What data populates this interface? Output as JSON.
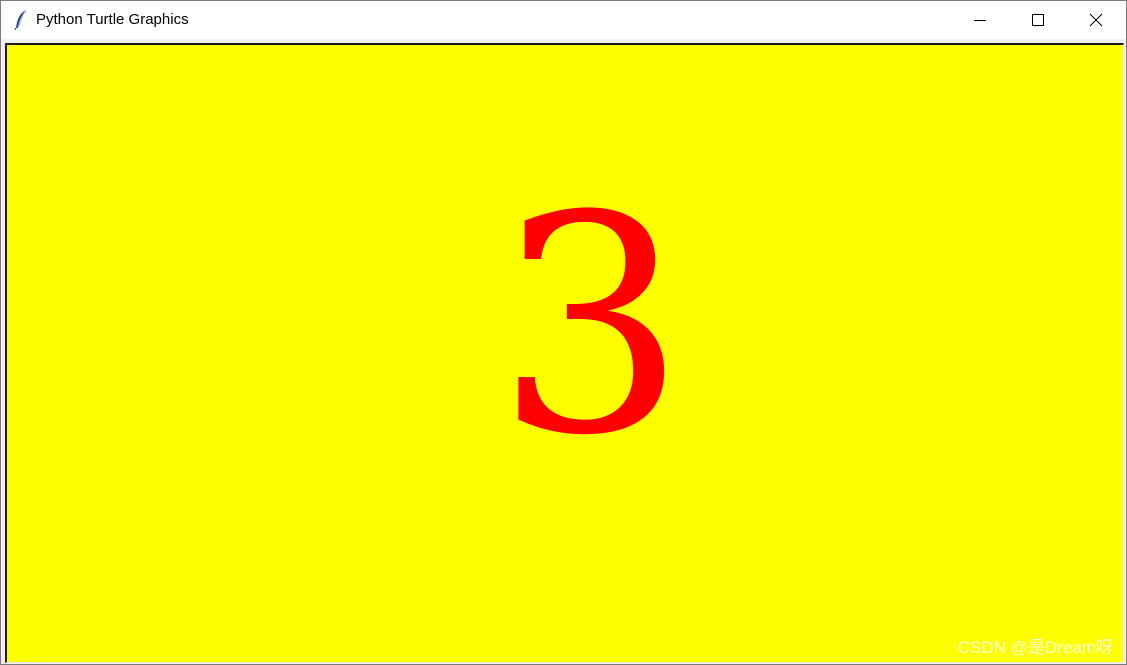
{
  "window": {
    "title": "Python Turtle Graphics",
    "app_icon": "feather-icon",
    "controls": {
      "minimize_icon": "minimize-icon",
      "maximize_icon": "maximize-icon",
      "close_icon": "close-icon"
    }
  },
  "canvas": {
    "background_color": "#ffff00",
    "text": "3",
    "text_color": "#ff0000"
  },
  "watermark": {
    "text": "CSDN @是Dream呀"
  }
}
